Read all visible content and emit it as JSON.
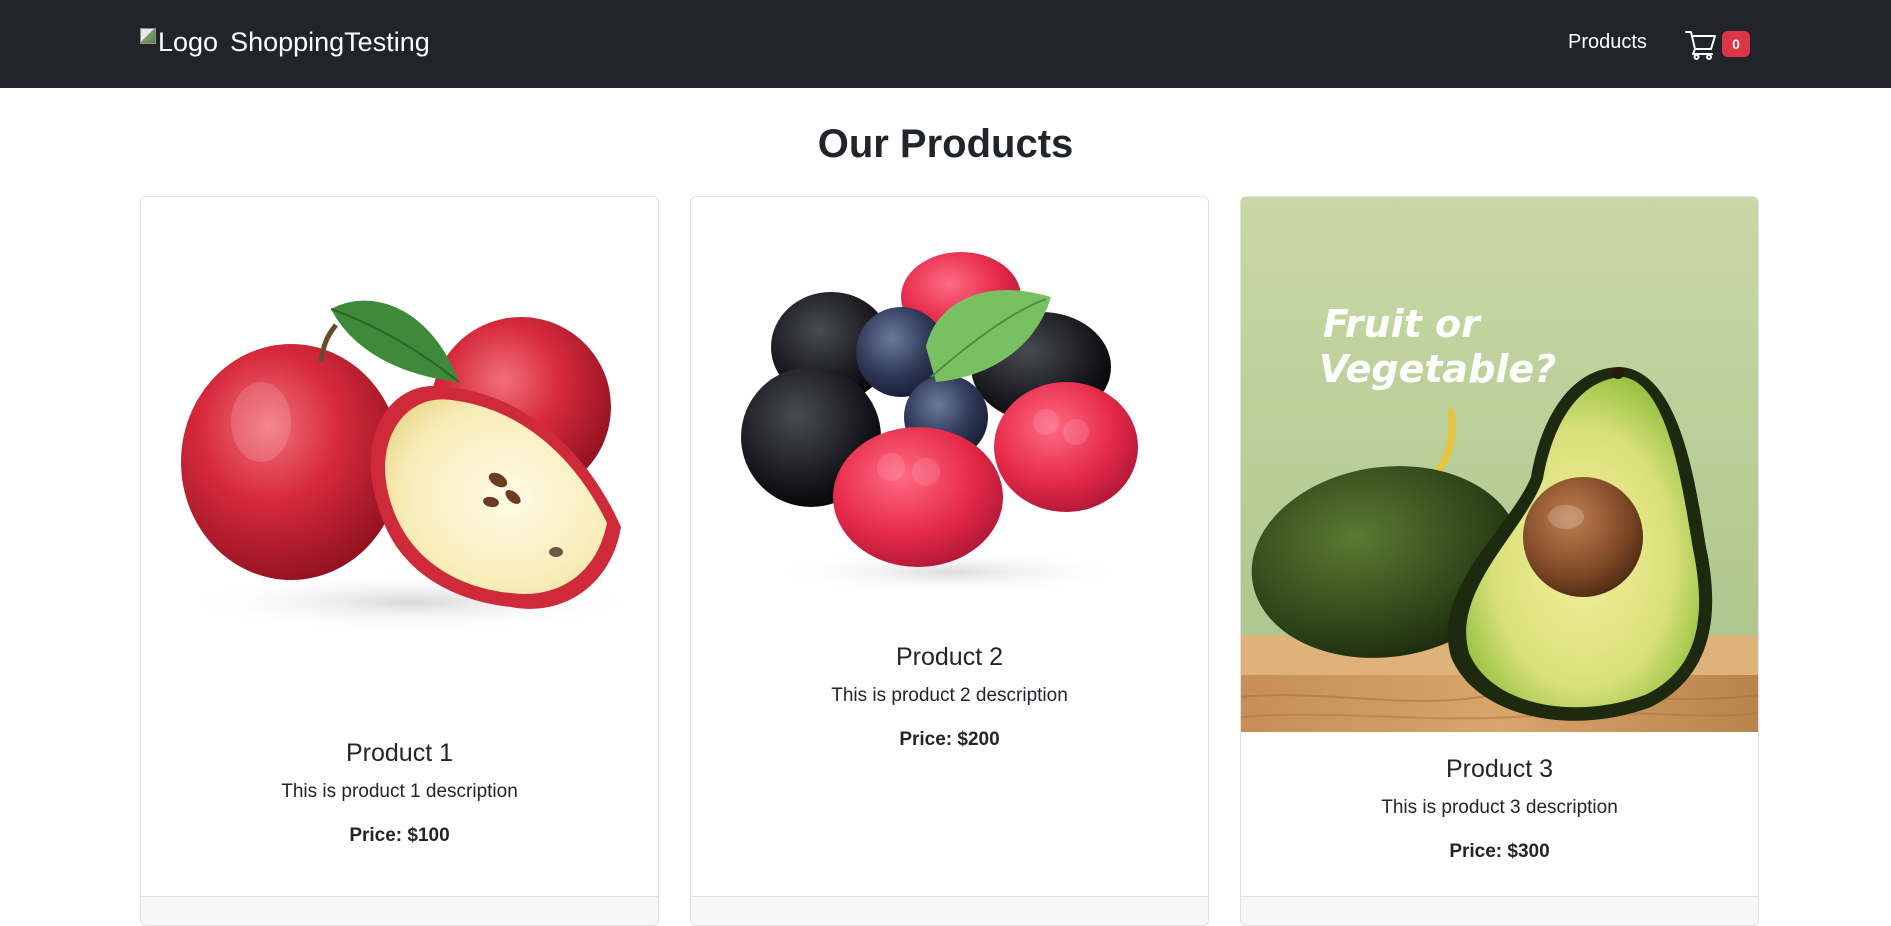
{
  "navbar": {
    "logo_alt": "Logo",
    "brand_name": "ShoppingTesting",
    "products_link": "Products",
    "cart_icon": "shopping-cart-icon",
    "cart_count": "0",
    "background_color": "#212529",
    "badge_color": "#dc3545"
  },
  "main": {
    "title": "Our Products"
  },
  "products": [
    {
      "image": "red-apples-image",
      "name": "Product 1",
      "description": "This is product 1 description",
      "price_label": "Price:",
      "price_value": "$100"
    },
    {
      "image": "mixed-berries-image",
      "name": "Product 2",
      "description": "This is product 2 description",
      "price_label": "Price:",
      "price_value": "$200"
    },
    {
      "image": "avocado-image",
      "image_caption": "Fruit or Vegetable?",
      "name": "Product 3",
      "description": "This is product 3 description",
      "price_label": "Price:",
      "price_value": "$300"
    }
  ]
}
